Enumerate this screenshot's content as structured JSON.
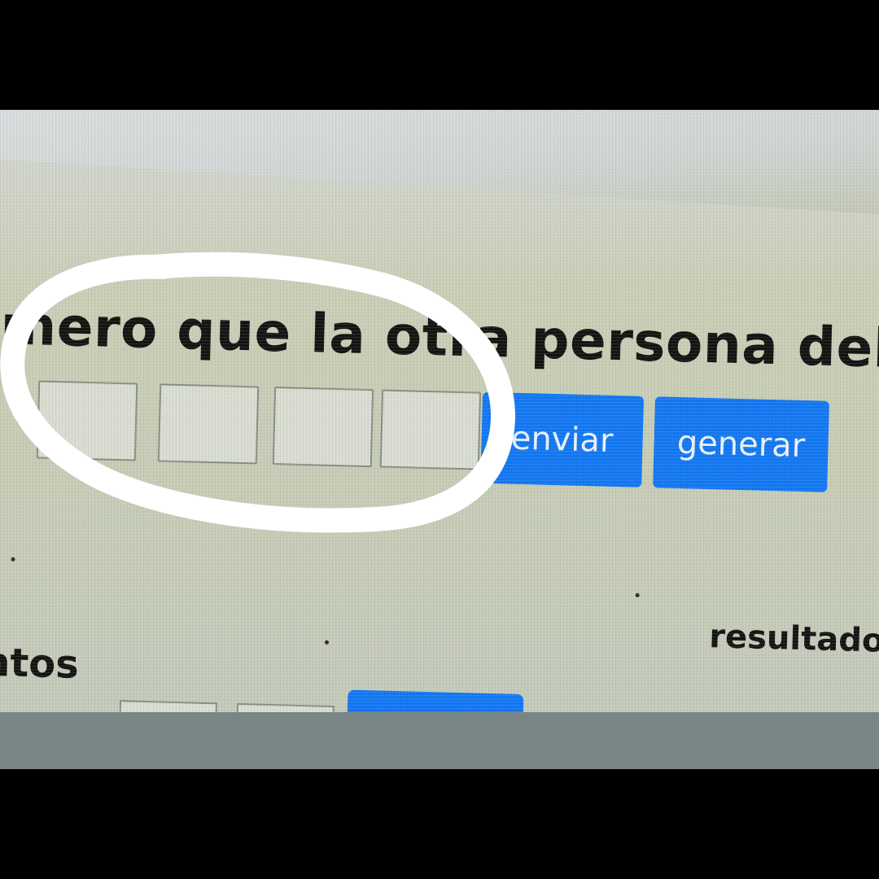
{
  "form": {
    "heading": "umero que la otra persona deb",
    "digit_boxes": [
      "",
      "",
      "",
      ""
    ],
    "send_button_label": "enviar",
    "generate_button_label": "generar"
  },
  "lower_section": {
    "left_label": "ntos",
    "results_label": "resultados"
  },
  "colors": {
    "button_blue": "#1378f2",
    "annotation_white": "#ffffff"
  }
}
